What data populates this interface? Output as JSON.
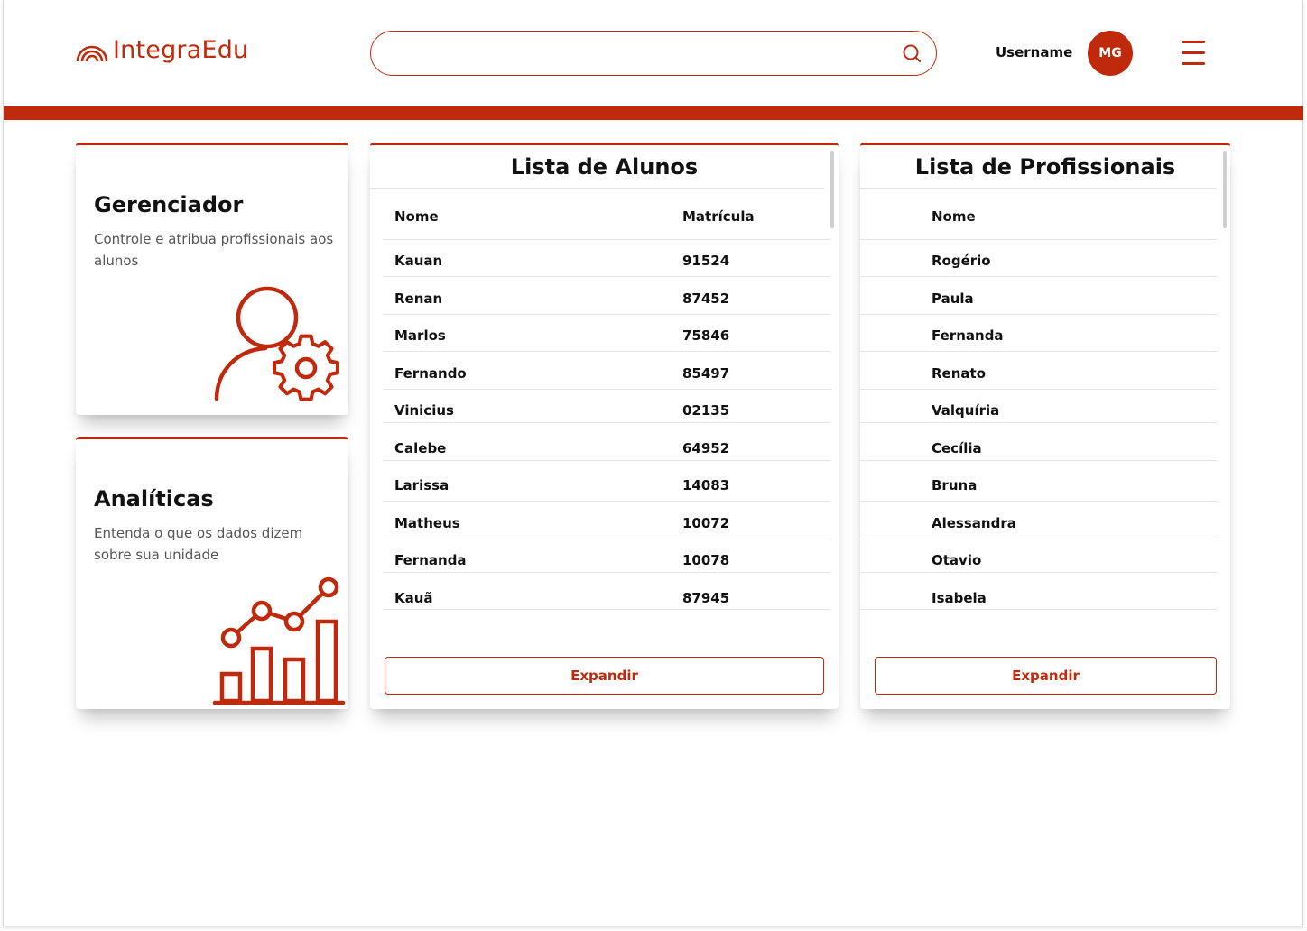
{
  "brand": {
    "name": "IntegraEdu",
    "color": "#c02a0c"
  },
  "header": {
    "search_value": "",
    "search_placeholder": "",
    "username": "Username",
    "avatar_initials": "MG",
    "icons": {
      "search": "search-icon",
      "menu": "hamburger-menu-icon",
      "logo": "rainbow-logo-icon"
    }
  },
  "cards": {
    "manager": {
      "title": "Gerenciador",
      "description": "Controle e atribua profissionais aos alunos",
      "icon": "user-gear-icon"
    },
    "analytics": {
      "title": "Analíticas",
      "description": "Entenda o que os dados dizem sobre sua unidade",
      "icon": "bar-line-chart-icon"
    }
  },
  "students": {
    "title": "Lista de Alunos",
    "columns": [
      "Nome",
      "Matrícula"
    ],
    "rows": [
      [
        "Kauan",
        "91524"
      ],
      [
        "Renan",
        "87452"
      ],
      [
        "Marlos",
        "75846"
      ],
      [
        "Fernando",
        "85497"
      ],
      [
        "Vinicius",
        "02135"
      ],
      [
        "Calebe",
        "64952"
      ],
      [
        "Larissa",
        "14083"
      ],
      [
        "Matheus",
        "10072"
      ],
      [
        "Fernanda",
        "10078"
      ],
      [
        "Kauã",
        "87945"
      ]
    ],
    "expand_label": "Expandir"
  },
  "professionals": {
    "title": "Lista de Profissionais",
    "columns": [
      "Nome"
    ],
    "rows": [
      "Rogério",
      "Paula",
      "Fernanda",
      "Renato",
      "Valquíria",
      "Cecília",
      "Bruna",
      "Alessandra",
      "Otavio",
      "Isabela"
    ],
    "expand_label": "Expandir"
  }
}
